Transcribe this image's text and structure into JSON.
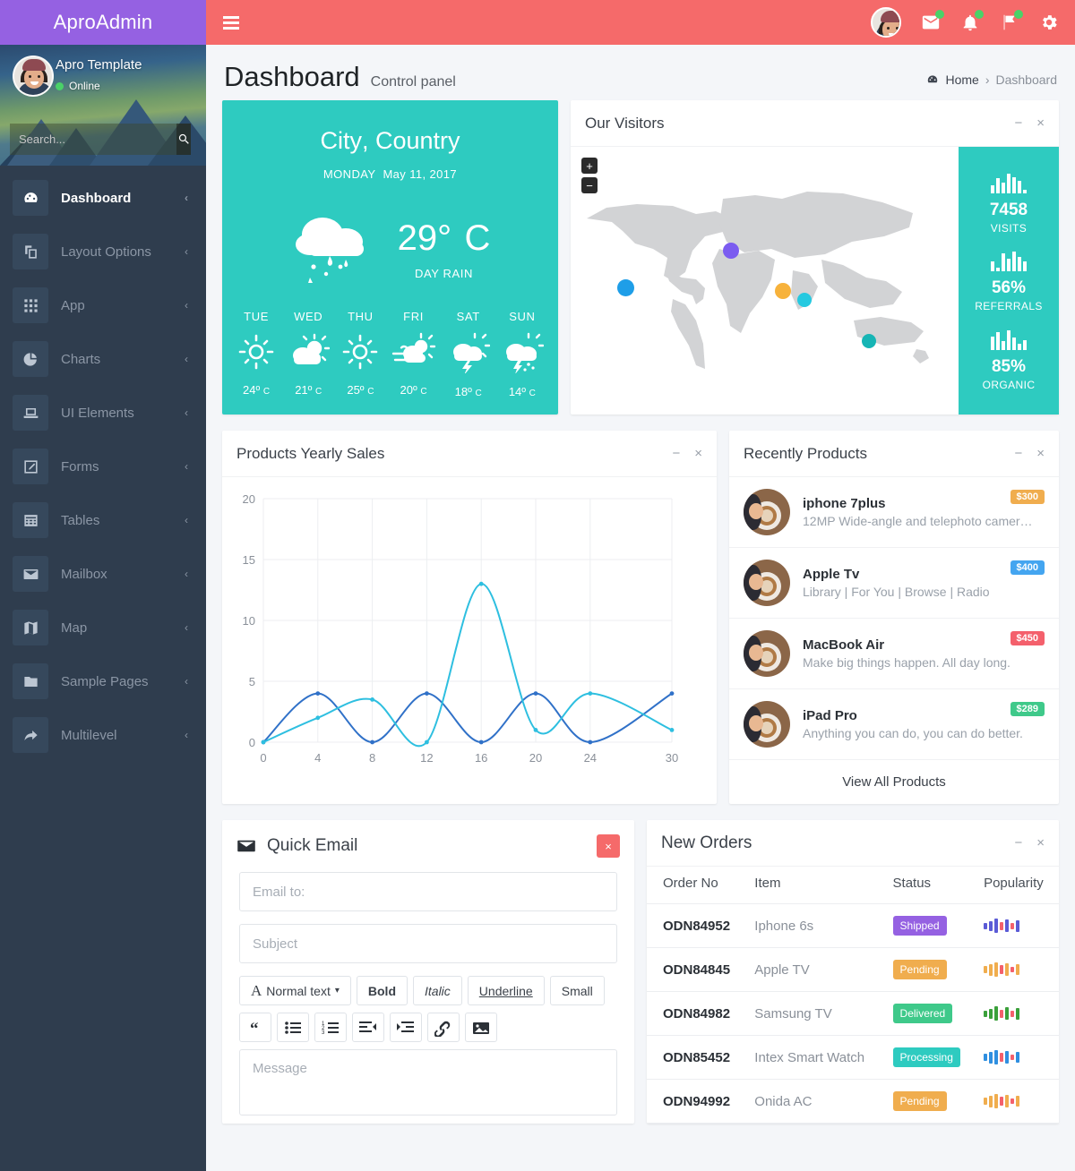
{
  "brand": {
    "name": "AproAdmin",
    "color": "#9561e2"
  },
  "navbar": {
    "color": "#f56a6a",
    "hamburger": "menu-icon",
    "icons": [
      {
        "name": "messages-icon",
        "glyph": "envelope",
        "badge": true
      },
      {
        "name": "notifications-icon",
        "glyph": "bell",
        "badge": true
      },
      {
        "name": "flags-icon",
        "glyph": "flag",
        "badge": true
      },
      {
        "name": "settings-icon",
        "glyph": "gear",
        "badge": false
      }
    ]
  },
  "user": {
    "name": "Apro Template",
    "status": "Online",
    "status_color": "#4ad168"
  },
  "search": {
    "placeholder": "Search...",
    "value": "",
    "button_icon": "search-icon"
  },
  "sidebar": {
    "items": [
      {
        "label": "Dashboard",
        "icon": "dashboard-icon",
        "active": true,
        "arrow": "‹"
      },
      {
        "label": "Layout Options",
        "icon": "layers-icon",
        "active": false,
        "arrow": "‹"
      },
      {
        "label": "App",
        "icon": "grid-icon",
        "active": false,
        "arrow": "‹"
      },
      {
        "label": "Charts",
        "icon": "pie-chart-icon",
        "active": false,
        "arrow": "‹"
      },
      {
        "label": "UI Elements",
        "icon": "laptop-icon",
        "active": false,
        "arrow": "‹"
      },
      {
        "label": "Forms",
        "icon": "edit-icon",
        "active": false,
        "arrow": "‹"
      },
      {
        "label": "Tables",
        "icon": "table-icon",
        "active": false,
        "arrow": "‹"
      },
      {
        "label": "Mailbox",
        "icon": "envelope-icon",
        "active": false,
        "arrow": "‹"
      },
      {
        "label": "Map",
        "icon": "map-icon",
        "active": false,
        "arrow": "‹"
      },
      {
        "label": "Sample Pages",
        "icon": "folder-icon",
        "active": false,
        "arrow": "‹"
      },
      {
        "label": "Multilevel",
        "icon": "share-icon",
        "active": false,
        "arrow": "‹"
      }
    ]
  },
  "page": {
    "title": "Dashboard",
    "subtitle": "Control panel",
    "breadcrumb": {
      "home": "Home",
      "sep": "›",
      "current": "Dashboard",
      "home_icon": "dashboard-icon"
    }
  },
  "weather": {
    "accent": "#2ecbc0",
    "city": "City",
    "comma": ", ",
    "country": "Country",
    "day": "MONDAY",
    "date": "May 11, 2017",
    "temp": "29°",
    "unit": "C",
    "condition": "DAY RAIN",
    "icon": "rain-cloud-icon",
    "forecast": [
      {
        "day": "TUE",
        "icon": "sun-icon",
        "temp": "24º",
        "unit": "C"
      },
      {
        "day": "WED",
        "icon": "sun-cloud-icon",
        "temp": "21º",
        "unit": "C"
      },
      {
        "day": "THU",
        "icon": "sun-icon",
        "temp": "25º",
        "unit": "C"
      },
      {
        "day": "FRI",
        "icon": "wind-cloud-icon",
        "temp": "20º",
        "unit": "C"
      },
      {
        "day": "SAT",
        "icon": "storm-cloud-icon",
        "temp": "18º",
        "unit": "C"
      },
      {
        "day": "SUN",
        "icon": "storm-rain-icon",
        "temp": "14º",
        "unit": "C"
      }
    ]
  },
  "visitors": {
    "title": "Our Visitors",
    "minimize": "−",
    "close": "×",
    "zoom_in": "+",
    "zoom_out": "−",
    "markers": [
      {
        "name": "marker-north-america",
        "color": "#1e9ee8",
        "x": 52,
        "y": 148,
        "size": 19
      },
      {
        "name": "marker-europe",
        "color": "#7b5cf0",
        "x": 170,
        "y": 107,
        "size": 18
      },
      {
        "name": "marker-middle-east",
        "color": "#f7b23b",
        "x": 228,
        "y": 152,
        "size": 18
      },
      {
        "name": "marker-south-asia",
        "color": "#25c9e0",
        "x": 253,
        "y": 163,
        "size": 16
      },
      {
        "name": "marker-australia",
        "color": "#16b5b5",
        "x": 325,
        "y": 209,
        "size": 16
      }
    ],
    "stats": [
      {
        "value": "7458",
        "label": "VISITS",
        "bars": [
          9,
          17,
          12,
          22,
          18,
          14,
          4
        ]
      },
      {
        "value": "56%",
        "label": "REFERRALS",
        "bars": [
          11,
          4,
          20,
          14,
          22,
          16,
          11
        ]
      },
      {
        "value": "85%",
        "label": "ORGANIC",
        "bars": [
          15,
          20,
          10,
          22,
          14,
          7,
          11
        ]
      }
    ]
  },
  "sales": {
    "title": "Products Yearly Sales",
    "minimize": "−",
    "close": "×"
  },
  "chart_data": {
    "type": "line",
    "title": "Products Yearly Sales",
    "xlabel": "",
    "ylabel": "",
    "x": [
      0,
      4,
      8,
      12,
      16,
      20,
      24,
      30
    ],
    "xticks": [
      "0",
      "4",
      "8",
      "12",
      "16",
      "20",
      "24",
      "30"
    ],
    "yticks": [
      "0",
      "5",
      "10",
      "15",
      "20"
    ],
    "xlim": [
      0,
      30
    ],
    "ylim": [
      0,
      20
    ],
    "grid": true,
    "legend": "none",
    "series": [
      {
        "name": "Series 1",
        "color": "#3071c8",
        "values": [
          0,
          4,
          0,
          4,
          0,
          4,
          0,
          4
        ]
      },
      {
        "name": "Series 2",
        "color": "#2ebfe0",
        "values": [
          0,
          2,
          3.5,
          0,
          13,
          1,
          4,
          1
        ]
      }
    ]
  },
  "products": {
    "title": "Recently Products",
    "minimize": "−",
    "close": "×",
    "view_all": "View All Products",
    "items": [
      {
        "name": "iphone 7plus",
        "desc": "12MP Wide-angle and telephoto camer…",
        "price": "$300",
        "color": "#f0ad4e",
        "image": "coffee-cup-avatar"
      },
      {
        "name": "Apple Tv",
        "desc": "Library | For You | Browse | Radio",
        "price": "$400",
        "color": "#44a5f0",
        "image": "coffee-cup-avatar"
      },
      {
        "name": "MacBook Air",
        "desc": "Make big things happen. All day long.",
        "price": "$450",
        "color": "#f4606c",
        "image": "coffee-cup-avatar"
      },
      {
        "name": "iPad Pro",
        "desc": "Anything you can do, you can do better.",
        "price": "$289",
        "color": "#3fc98a",
        "image": "coffee-cup-avatar"
      }
    ]
  },
  "quick_email": {
    "title": "Quick Email",
    "icon": "envelope-icon",
    "close": "×",
    "to_placeholder": "Email to:",
    "to_value": "",
    "subject_placeholder": "Subject",
    "subject_value": "",
    "message_placeholder": "Message",
    "message_value": "",
    "format_label": "Normal text",
    "format_caret": "▾",
    "format_icon": "font-icon",
    "bold": "Bold",
    "italic": "Italic",
    "underline": "Underline",
    "small": "Small",
    "tools": [
      {
        "name": "blockquote-icon",
        "glyph": "“"
      },
      {
        "name": "unordered-list-icon",
        "glyph": "ul"
      },
      {
        "name": "ordered-list-icon",
        "glyph": "ol"
      },
      {
        "name": "outdent-icon",
        "glyph": "outdent"
      },
      {
        "name": "indent-icon",
        "glyph": "indent"
      },
      {
        "name": "link-icon",
        "glyph": "link"
      },
      {
        "name": "image-icon",
        "glyph": "image"
      }
    ]
  },
  "orders": {
    "title": "New Orders",
    "minimize": "−",
    "close": "×",
    "columns": [
      "Order No",
      "Item",
      "Status",
      "Popularity"
    ],
    "rows": [
      {
        "order_no": "ODN84952",
        "item": "Iphone 6s",
        "status": "Shipped",
        "status_color": "#9561e2",
        "bars": [
          [
            7,
            "#5b5bd6"
          ],
          [
            11,
            "#5b5bd6"
          ],
          [
            16,
            "#5b5bd6"
          ],
          [
            9,
            "#f4606c"
          ],
          [
            14,
            "#5b5bd6"
          ],
          [
            7,
            "#f4606c"
          ],
          [
            13,
            "#5b5bd6"
          ]
        ]
      },
      {
        "order_no": "ODN84845",
        "item": "Apple TV",
        "status": "Pending",
        "status_color": "#f0ad4e",
        "bars": [
          [
            8,
            "#f0ad4e"
          ],
          [
            13,
            "#f0ad4e"
          ],
          [
            16,
            "#f0ad4e"
          ],
          [
            10,
            "#f4606c"
          ],
          [
            14,
            "#f0ad4e"
          ],
          [
            6,
            "#f4606c"
          ],
          [
            12,
            "#f0ad4e"
          ]
        ]
      },
      {
        "order_no": "ODN84982",
        "item": "Samsung TV",
        "status": "Delivered",
        "status_color": "#3fc98a",
        "bars": [
          [
            7,
            "#3aa03a"
          ],
          [
            11,
            "#3aa03a"
          ],
          [
            16,
            "#3aa03a"
          ],
          [
            9,
            "#f4606c"
          ],
          [
            14,
            "#3aa03a"
          ],
          [
            7,
            "#f4606c"
          ],
          [
            13,
            "#3aa03a"
          ]
        ]
      },
      {
        "order_no": "ODN85452",
        "item": "Intex Smart Watch",
        "status": "Processing",
        "status_color": "#2ecbc0",
        "bars": [
          [
            8,
            "#2f8fe0"
          ],
          [
            13,
            "#2f8fe0"
          ],
          [
            16,
            "#2f8fe0"
          ],
          [
            10,
            "#f4606c"
          ],
          [
            14,
            "#2f8fe0"
          ],
          [
            6,
            "#f4606c"
          ],
          [
            12,
            "#2f8fe0"
          ]
        ]
      },
      {
        "order_no": "ODN94992",
        "item": "Onida AC",
        "status": "Pending",
        "status_color": "#f0ad4e",
        "bars": [
          [
            8,
            "#f0ad4e"
          ],
          [
            13,
            "#f0ad4e"
          ],
          [
            16,
            "#f0ad4e"
          ],
          [
            10,
            "#f4606c"
          ],
          [
            14,
            "#f0ad4e"
          ],
          [
            6,
            "#f4606c"
          ],
          [
            12,
            "#f0ad4e"
          ]
        ]
      }
    ]
  }
}
